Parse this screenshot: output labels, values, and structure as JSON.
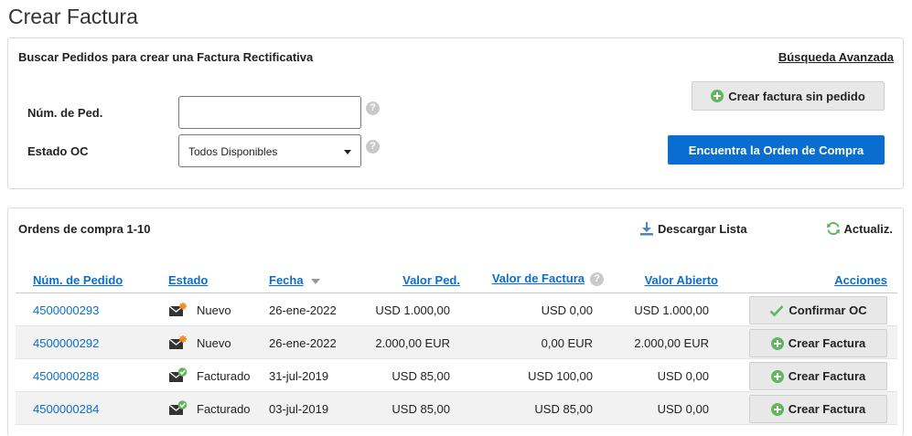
{
  "page": {
    "title": "Crear Factura"
  },
  "search": {
    "title": "Buscar Pedidos para crear una Factura Rectificativa",
    "advanced_link": "Búsqueda Avanzada",
    "order_label": "Núm. de Ped.",
    "order_value": "",
    "status_label": "Estado OC",
    "status_value": "Todos Disponibles",
    "help_glyph": "?",
    "create_without_order": "Crear factura sin pedido",
    "find_order": "Encuentra la Orden de Compra"
  },
  "orders": {
    "title": "Ordens de compra 1-10",
    "download": "Descargar Lista",
    "refresh": "Actualiz.",
    "columns": {
      "order": "Núm. de Pedido",
      "status": "Estado",
      "date": "Fecha",
      "order_value": "Valor Ped.",
      "invoice_value": "Valor de Factura",
      "open_value": "Valor Abierto",
      "actions": "Acciones"
    },
    "rows": [
      {
        "order": "4500000293",
        "status": "Nuevo",
        "status_icon": "envelope-new-icon",
        "date": "26-ene-2022",
        "order_value": "USD 1.000,00",
        "invoice_value": "USD 0,00",
        "open_value": "USD 1.000,00",
        "action": "Confirmar OC",
        "action_icon": "check-icon"
      },
      {
        "order": "4500000292",
        "status": "Nuevo",
        "status_icon": "envelope-new-icon",
        "date": "26-ene-2022",
        "order_value": "2.000,00 EUR",
        "invoice_value": "0,00 EUR",
        "open_value": "2.000,00 EUR",
        "action": "Crear Factura",
        "action_icon": "plus-icon"
      },
      {
        "order": "4500000288",
        "status": "Facturado",
        "status_icon": "envelope-invoiced-icon",
        "date": "31-jul-2019",
        "order_value": "USD 85,00",
        "invoice_value": "USD 100,00",
        "open_value": "USD 0,00",
        "action": "Crear Factura",
        "action_icon": "plus-icon"
      },
      {
        "order": "4500000284",
        "status": "Facturado",
        "status_icon": "envelope-invoiced-icon",
        "date": "03-jul-2019",
        "order_value": "USD 85,00",
        "invoice_value": "USD 85,00",
        "open_value": "USD 0,00",
        "action": "Crear Factura",
        "action_icon": "plus-icon"
      }
    ]
  },
  "colors": {
    "primary": "#0a6ed1",
    "success": "#5fb85f",
    "accent_orange": "#f08c1e"
  }
}
